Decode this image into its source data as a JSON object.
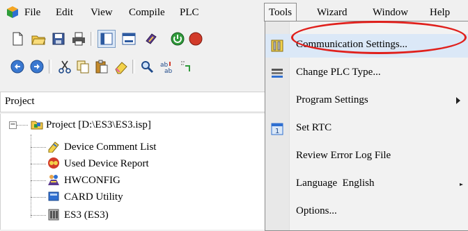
{
  "menubar": {
    "items": [
      "File",
      "Edit",
      "View",
      "Compile",
      "PLC",
      "Tools",
      "Wizard",
      "Window",
      "Help"
    ],
    "active": "Tools"
  },
  "toolbar": {
    "row1_icons": [
      "new-file-icon",
      "open-folder-icon",
      "save-icon",
      "print-icon",
      "layout-icon",
      "window-icon",
      "device-icon",
      "plc-run-icon",
      "plc-stop-icon"
    ],
    "row2_icons": [
      "undo-icon",
      "redo-icon",
      "cut-icon",
      "copy-icon",
      "paste-icon",
      "eraser-icon",
      "search-icon",
      "replace-icon",
      "goto-icon"
    ]
  },
  "project": {
    "header": "Project",
    "root": "Project [D:\\ES3\\ES3.isp]",
    "items": [
      {
        "label": "Device Comment List",
        "icon": "comment-list-icon"
      },
      {
        "label": "Used Device Report",
        "icon": "device-report-icon"
      },
      {
        "label": "HWCONFIG",
        "icon": "hwconfig-icon"
      },
      {
        "label": "CARD Utility",
        "icon": "card-utility-icon"
      },
      {
        "label": "ES3 (ES3)",
        "icon": "plc-device-icon"
      }
    ]
  },
  "tools_menu": {
    "items": [
      {
        "label": "Communication Settings...",
        "icon": "communication-icon",
        "highlighted": true
      },
      {
        "label": "Change PLC Type...",
        "icon": "change-plc-icon"
      },
      {
        "label": "Program Settings",
        "submenu": true
      },
      {
        "label": "Set RTC",
        "icon": "calendar-icon"
      },
      {
        "label": "Review Error Log File"
      },
      {
        "label": "Language  English",
        "submenu": true
      },
      {
        "label": "Options..."
      }
    ]
  },
  "colors": {
    "annotation": "#e0201c",
    "hover": "#dbe8f7"
  }
}
